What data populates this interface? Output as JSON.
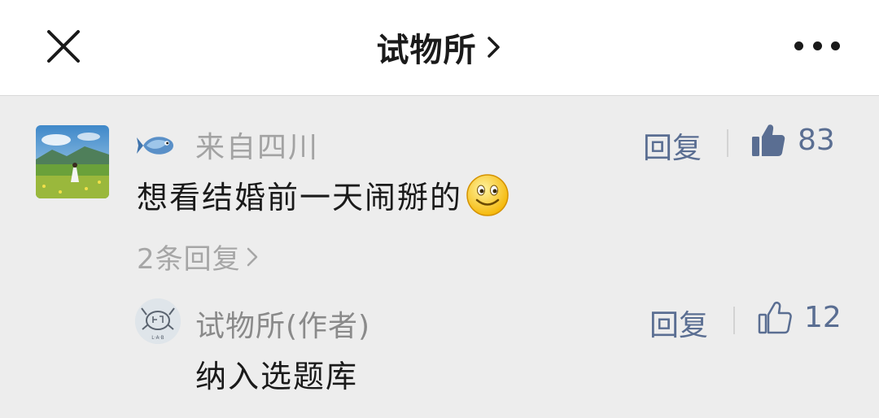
{
  "header": {
    "title": "试物所",
    "close_icon": "close-icon",
    "more_icon": "more-icon"
  },
  "comment": {
    "origin": "来自四川",
    "reply_label": "回复",
    "likes": "83",
    "text": "想看结婚前一天闹掰的",
    "replies_link": "2条回复",
    "colors": {
      "link": "#5a6e92",
      "meta": "#a3a3a3"
    }
  },
  "reply": {
    "author": "试物所(作者)",
    "reply_label": "回复",
    "likes": "12",
    "text": "纳入选题库",
    "avatar_text": "L·A·B"
  }
}
